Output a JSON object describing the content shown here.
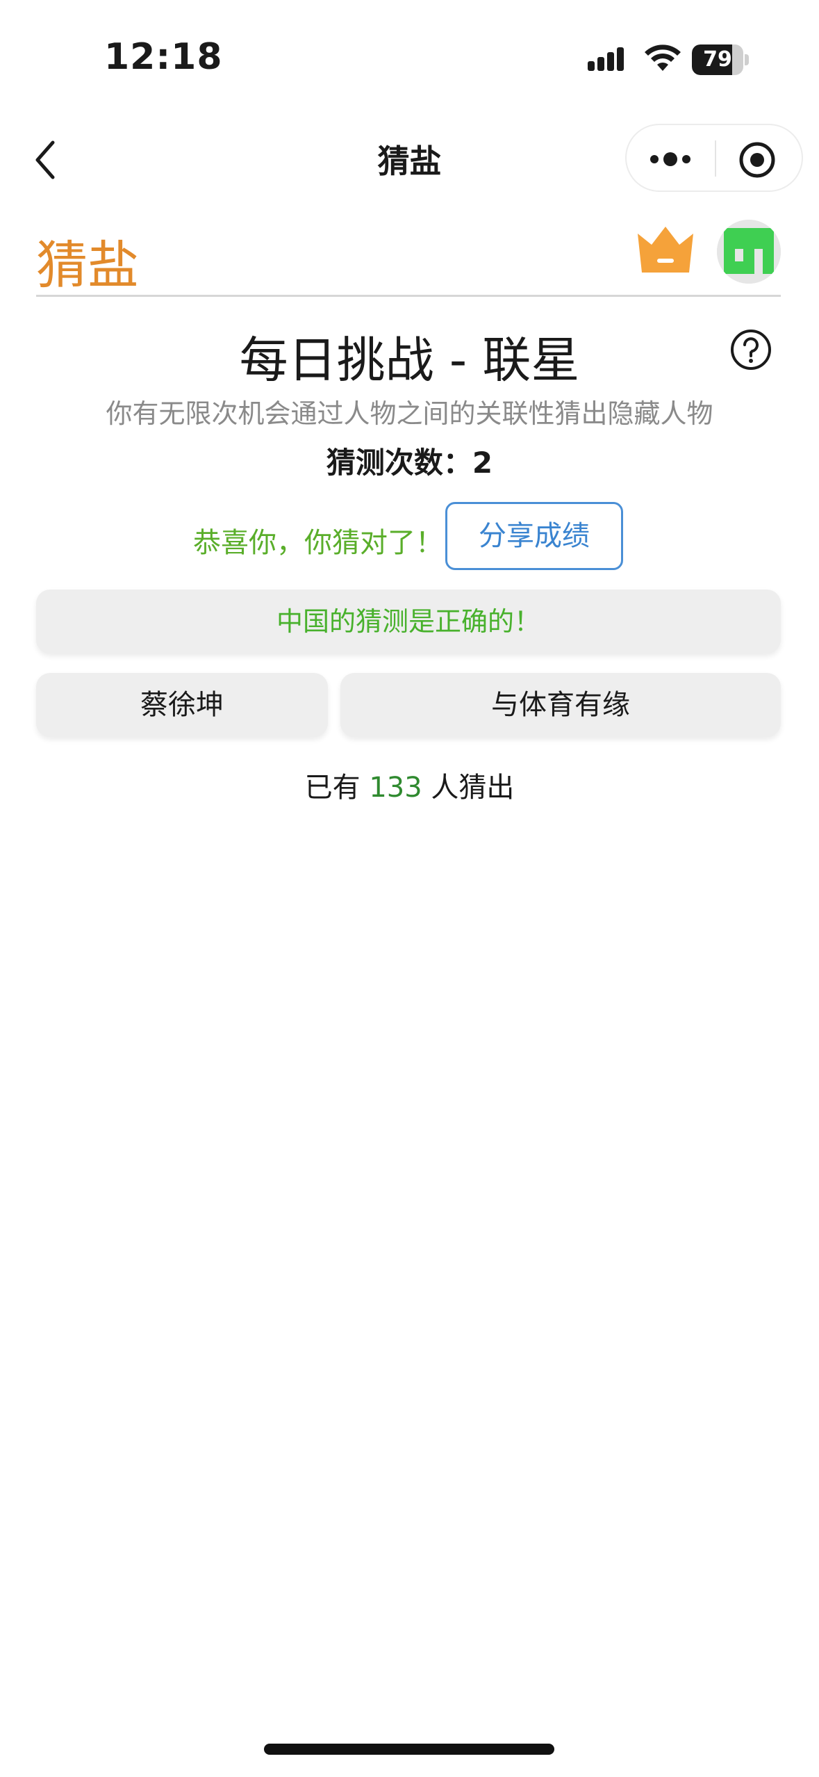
{
  "status_bar": {
    "time": "12:18",
    "battery": "79",
    "battery_level": 0.79
  },
  "nav": {
    "title": "猜盐"
  },
  "app": {
    "logo": "猜盐"
  },
  "challenge": {
    "title": "每日挑战 - 联星",
    "subtitle": "你有无限次机会通过人物之间的关联性猜出隐藏人物",
    "guess_count_label": "猜测次数：",
    "guess_count": "2"
  },
  "result": {
    "congrats": "恭喜你，你猜对了！",
    "share_label": "分享成绩",
    "correct_message": "中国的猜测是正确的！"
  },
  "guesses": [
    {
      "person": "蔡徐坤",
      "relation": "与体育有缘"
    }
  ],
  "stats": {
    "prefix": "已有",
    "count": "133",
    "suffix": "人猜出"
  },
  "colors": {
    "brand": "#e28a2b",
    "success": "#5aae2a",
    "link": "#3a84d0",
    "count_green": "#2f8a2f"
  }
}
